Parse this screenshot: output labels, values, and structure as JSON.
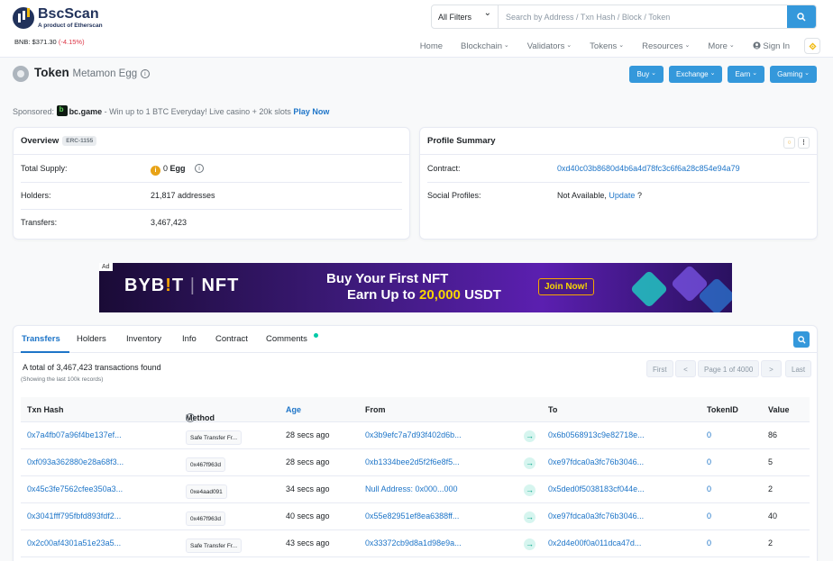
{
  "brand": {
    "name": "BscScan",
    "tagline": "A product of Etherscan"
  },
  "price": {
    "label": "BNB:",
    "value": "$371.30",
    "change": "(-4.15%)"
  },
  "search": {
    "filter": "All Filters",
    "placeholder": "Search by Address / Txn Hash / Block / Token"
  },
  "nav": {
    "home": "Home",
    "blockchain": "Blockchain",
    "validators": "Validators",
    "tokens": "Tokens",
    "resources": "Resources",
    "more": "More",
    "signin": "Sign In"
  },
  "token": {
    "label": "Token",
    "name": "Metamon Egg"
  },
  "buttons": {
    "buy": "Buy",
    "exchange": "Exchange",
    "earn": "Earn",
    "gaming": "Gaming"
  },
  "sponsor": {
    "label": "Sponsored:",
    "name": "bc.game",
    "text": " - Win up to 1 BTC Everyday! Live casino + 20k slots ",
    "cta": "Play Now"
  },
  "overview": {
    "title": "Overview",
    "badge": "ERC-1155",
    "total_supply_label": "Total Supply:",
    "total_supply_value": "0",
    "total_supply_unit": "Egg",
    "holders_label": "Holders:",
    "holders_value": "21,817 addresses",
    "transfers_label": "Transfers:",
    "transfers_value": "3,467,423"
  },
  "profile": {
    "title": "Profile Summary",
    "contract_label": "Contract:",
    "contract_value": "0xd40c03b8680d4b6a4d78fc3c6f6a28c854e94a79",
    "social_label": "Social Profiles:",
    "social_value": "Not Available,",
    "social_update": "Update",
    "social_q": "?"
  },
  "ad": {
    "tag": "Ad",
    "brand_a": "BYB",
    "brand_b": "!",
    "brand_c": "T",
    "brand_d": "NFT",
    "line1": "Buy Your First NFT",
    "line2a": "Earn Up to ",
    "line2b": "20,000",
    "line2c": " USDT",
    "cta": "Join Now!"
  },
  "tabs": [
    "Transfers",
    "Holders",
    "Inventory",
    "Info",
    "Contract",
    "Comments"
  ],
  "summary": {
    "total": "A total of 3,467,423 transactions found",
    "sub": "(Showing the last 100k records)"
  },
  "pager": {
    "first": "First",
    "prev": "<",
    "page": "Page 1 of 4000",
    "next": ">",
    "last": "Last"
  },
  "columns": {
    "hash": "Txn Hash",
    "method": "Method",
    "age": "Age",
    "from": "From",
    "to": "To",
    "tokenid": "TokenID",
    "value": "Value"
  },
  "rows": [
    {
      "hash": "0x7a4fb07a96f4be137ef...",
      "method": "Safe Transfer Fr...",
      "age": "28 secs ago",
      "from": "0x3b9efc7a7d93f402d6b...",
      "to": "0x6b0568913c9e82718e...",
      "tokenid": "0",
      "value": "86"
    },
    {
      "hash": "0xf093a362880e28a68f3...",
      "method": "0x467f963d",
      "age": "28 secs ago",
      "from": "0xb1334bee2d5f2f6e8f5...",
      "to": "0xe97fdca0a3fc76b3046...",
      "tokenid": "0",
      "value": "5"
    },
    {
      "hash": "0x45c3fe7562cfee350a3...",
      "method": "0xe4aad091",
      "age": "34 secs ago",
      "from": "Null Address: 0x000...000",
      "to": "0x5ded0f5038183cf044e...",
      "tokenid": "0",
      "value": "2"
    },
    {
      "hash": "0x3041fff795fbfd893fdf2...",
      "method": "0x467f963d",
      "age": "40 secs ago",
      "from": "0x55e82951ef8ea6388ff...",
      "to": "0xe97fdca0a3fc76b3046...",
      "tokenid": "0",
      "value": "40"
    },
    {
      "hash": "0x2c00af4301a51e23a5...",
      "method": "Safe Transfer Fr...",
      "age": "43 secs ago",
      "from": "0x33372cb9d8a1d98e9a...",
      "to": "0x2d4e00f0a011dca47d...",
      "tokenid": "0",
      "value": "2"
    }
  ],
  "colors": {
    "accent": "#3498db",
    "link": "#1e75c8",
    "negative": "#dc3545",
    "success": "#00c9a7"
  }
}
